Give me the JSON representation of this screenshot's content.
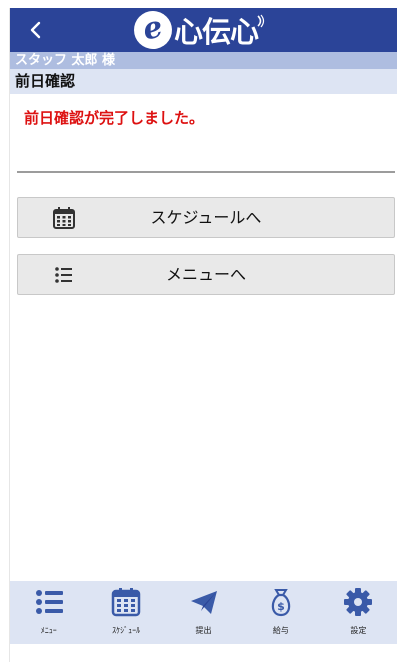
{
  "header": {
    "logo_e": "e",
    "logo_text": "心伝心"
  },
  "user_bar": {
    "text": "スタッフ 太郎 様"
  },
  "page_title": "前日確認",
  "message": "前日確認が完了しました。",
  "buttons": {
    "schedule": "スケジュールへ",
    "menu": "メニューへ"
  },
  "bottom_nav": [
    {
      "label": "ﾒﾆｭｰ",
      "icon": "list-icon"
    },
    {
      "label": "ｽｹｼﾞｭｰﾙ",
      "icon": "calendar-icon"
    },
    {
      "label": "提出",
      "icon": "paper-plane-icon"
    },
    {
      "label": "給与",
      "icon": "money-bag-icon"
    },
    {
      "label": "設定",
      "icon": "gear-icon"
    }
  ],
  "colors": {
    "header": "#2b4498",
    "user_bar": "#aebde0",
    "title_bar": "#dde4f3",
    "message": "#dd1111",
    "nav_icon": "#3a5aa8"
  }
}
